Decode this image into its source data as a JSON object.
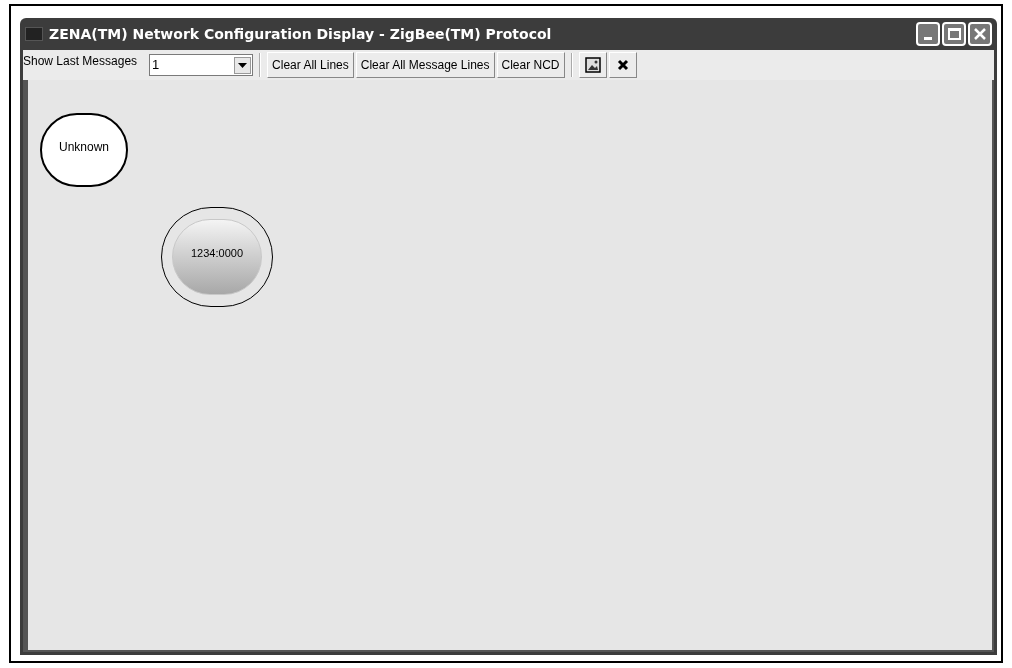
{
  "window": {
    "title": "ZENA(TM) Network Configuration Display - ZigBee(TM) Protocol"
  },
  "toolbar": {
    "label": "Show Last Messages",
    "dropdown": {
      "value": "1"
    },
    "buttons": [
      {
        "label": "Clear All Lines"
      },
      {
        "label": "Clear All Message Lines"
      },
      {
        "label": "Clear NCD"
      }
    ]
  },
  "nodes": [
    {
      "kind": "unknown",
      "label": "Unknown"
    },
    {
      "kind": "coordinator",
      "label": "1234:0000"
    }
  ]
}
